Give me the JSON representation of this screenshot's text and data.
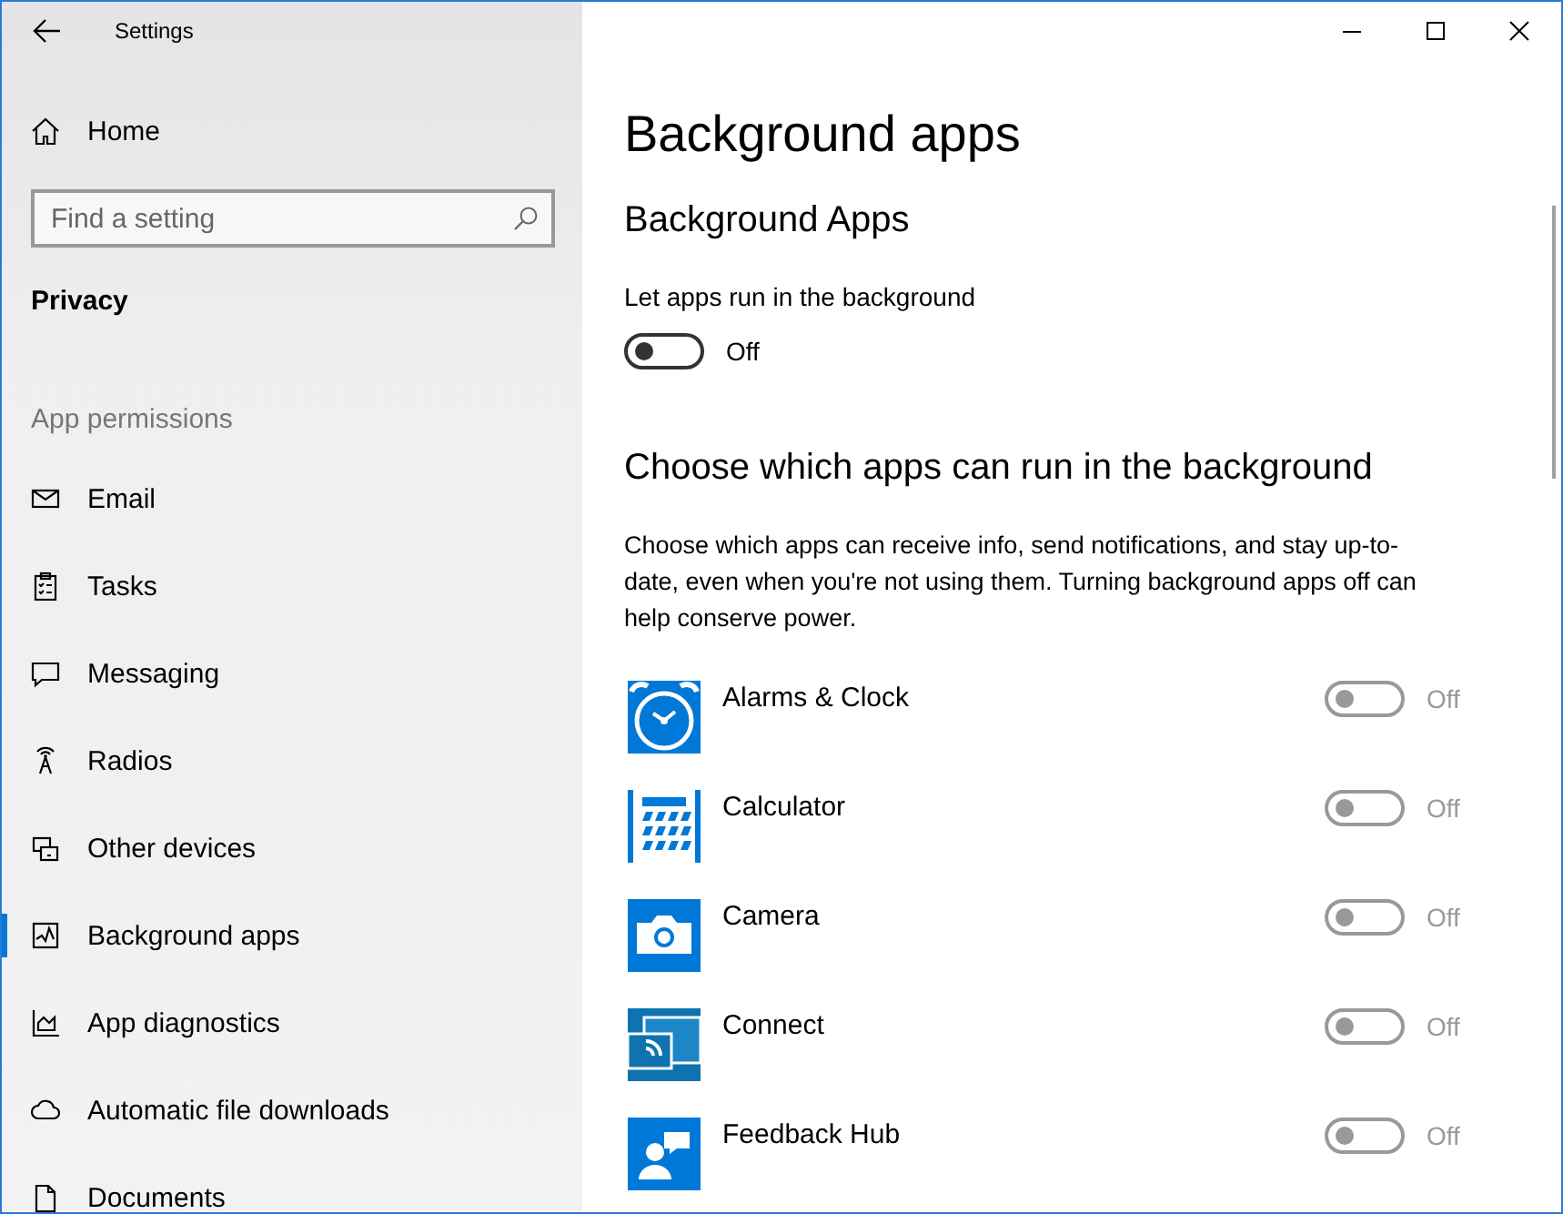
{
  "window": {
    "title": "Settings"
  },
  "sidebar": {
    "home": "Home",
    "search": {
      "placeholder": "Find a setting"
    },
    "category": "Privacy",
    "group_label": "App permissions",
    "items": [
      {
        "label": "Email",
        "selected": false
      },
      {
        "label": "Tasks",
        "selected": false
      },
      {
        "label": "Messaging",
        "selected": false
      },
      {
        "label": "Radios",
        "selected": false
      },
      {
        "label": "Other devices",
        "selected": false
      },
      {
        "label": "Background apps",
        "selected": true
      },
      {
        "label": "App diagnostics",
        "selected": false
      },
      {
        "label": "Automatic file downloads",
        "selected": false
      },
      {
        "label": "Documents",
        "selected": false
      }
    ]
  },
  "page": {
    "title": "Background apps",
    "section_title": "Background Apps",
    "master": {
      "label": "Let apps run in the background",
      "on": false,
      "disabled": false,
      "state_text": "Off"
    },
    "apps_title": "Choose which apps can run in the background",
    "description": "Choose which apps can receive info, send notifications, and stay up-to-date, even when you're not using them. Turning background apps off can help conserve power.",
    "apps": [
      {
        "name": "Alarms & Clock",
        "on": false,
        "disabled": true,
        "state_text": "Off"
      },
      {
        "name": "Calculator",
        "on": false,
        "disabled": true,
        "state_text": "Off"
      },
      {
        "name": "Camera",
        "on": false,
        "disabled": true,
        "state_text": "Off"
      },
      {
        "name": "Connect",
        "on": false,
        "disabled": true,
        "state_text": "Off"
      },
      {
        "name": "Feedback Hub",
        "on": false,
        "disabled": true,
        "state_text": "Off"
      }
    ]
  }
}
